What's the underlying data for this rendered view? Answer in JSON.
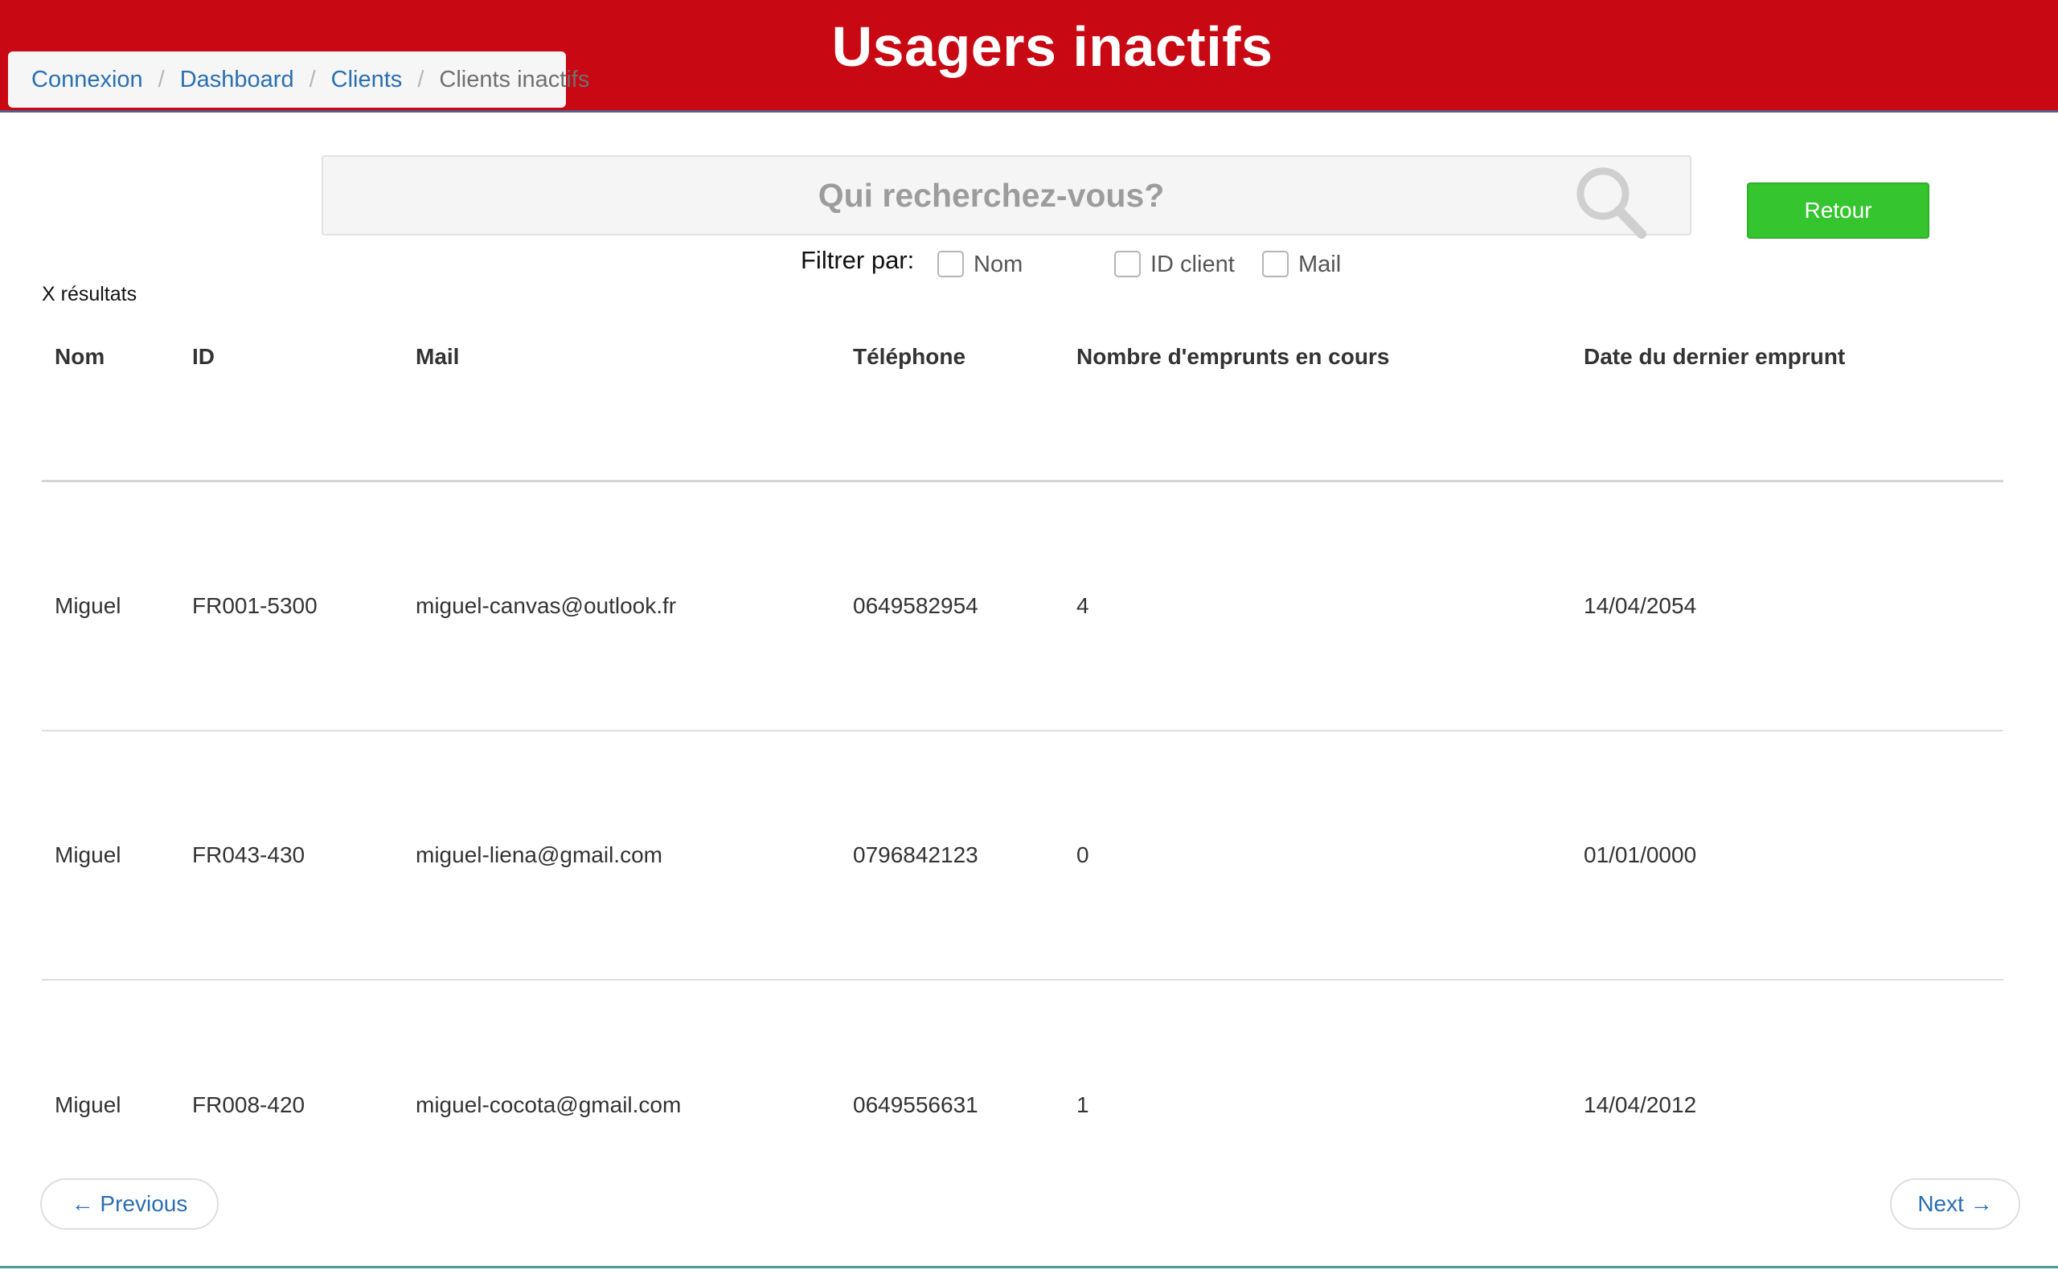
{
  "header": {
    "title": "Usagers inactifs"
  },
  "breadcrumb": {
    "items": [
      "Connexion",
      "Dashboard",
      "Clients"
    ],
    "separator": "/",
    "current": "Clients inactifs"
  },
  "search": {
    "placeholder": "Qui recherchez-vous?",
    "value": ""
  },
  "retour_button": "Retour",
  "filters": {
    "label": "Filtrer par:",
    "options": [
      {
        "label": "Nom",
        "checked": false
      },
      {
        "label": "ID client",
        "checked": false
      },
      {
        "label": "Mail",
        "checked": false
      }
    ]
  },
  "results": {
    "count_text": "X résultats"
  },
  "table": {
    "headers": [
      "Nom",
      "ID",
      "Mail",
      "Téléphone",
      "Nombre d'emprunts en cours",
      "Date du dernier emprunt"
    ],
    "rows": [
      [
        "Miguel",
        "FR001-5300",
        "miguel-canvas@outlook.fr",
        "0649582954",
        "4",
        "14/04/2054"
      ],
      [
        "Miguel",
        "FR043-430",
        "miguel-liena@gmail.com",
        "0796842123",
        "0",
        "01/01/0000"
      ],
      [
        "Miguel",
        "FR008-420",
        "miguel-cocota@gmail.com",
        "0649556631",
        "1",
        "14/04/2012"
      ]
    ]
  },
  "pagination": {
    "previous": "← Previous",
    "next": "Next →"
  },
  "colors": {
    "header_bg": "#c80812",
    "retour_bg": "#34c52f",
    "link": "#2a6fb0"
  }
}
